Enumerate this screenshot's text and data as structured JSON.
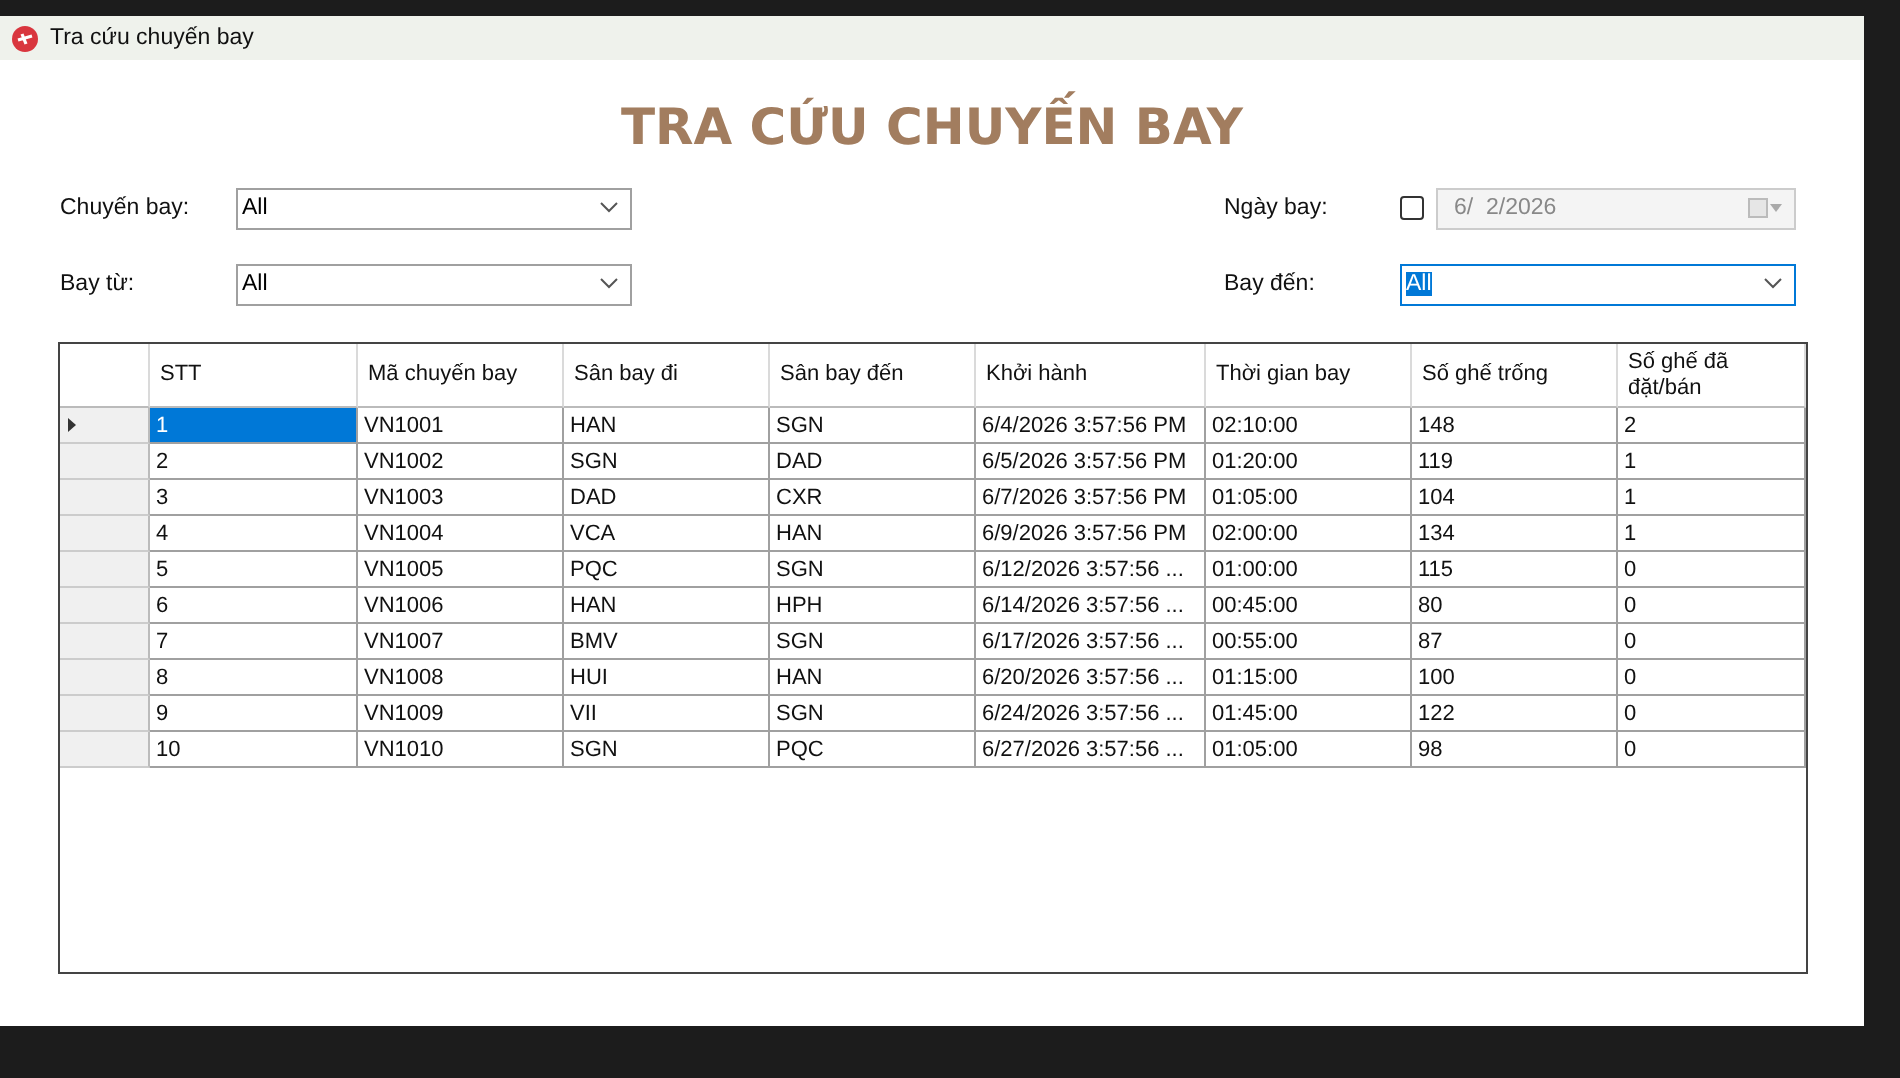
{
  "window": {
    "title": "Tra cứu chuyến bay"
  },
  "heading": "TRA CỨU CHUYẾN BAY",
  "filters": [
    {
      "kind": "combo",
      "label": "Chuyến bay:",
      "value": "All",
      "focused": false
    },
    {
      "kind": "date",
      "label": "Ngày bay:",
      "value": "6/  2/2026",
      "checked": false
    },
    {
      "kind": "combo",
      "label": "Bay từ:",
      "value": "All",
      "focused": false
    },
    {
      "kind": "combo",
      "label": "Bay đến:",
      "value": "All",
      "focused": true
    }
  ],
  "table": {
    "columns": [
      "STT",
      "Mã chuyến bay",
      "Sân bay đi",
      "Sân bay đến",
      "Khởi hành",
      "Thời gian bay",
      "Số ghế trống",
      "Số ghế đã đặt/bán"
    ],
    "rows": [
      {
        "selected": true,
        "cells": [
          "1",
          "VN1001",
          "HAN",
          "SGN",
          "6/4/2026 3:57:56 PM",
          "02:10:00",
          "148",
          "2"
        ]
      },
      {
        "selected": false,
        "cells": [
          "2",
          "VN1002",
          "SGN",
          "DAD",
          "6/5/2026 3:57:56 PM",
          "01:20:00",
          "119",
          "1"
        ]
      },
      {
        "selected": false,
        "cells": [
          "3",
          "VN1003",
          "DAD",
          "CXR",
          "6/7/2026 3:57:56 PM",
          "01:05:00",
          "104",
          "1"
        ]
      },
      {
        "selected": false,
        "cells": [
          "4",
          "VN1004",
          "VCA",
          "HAN",
          "6/9/2026 3:57:56 PM",
          "02:00:00",
          "134",
          "1"
        ]
      },
      {
        "selected": false,
        "cells": [
          "5",
          "VN1005",
          "PQC",
          "SGN",
          "6/12/2026 3:57:56 ...",
          "01:00:00",
          "115",
          "0"
        ]
      },
      {
        "selected": false,
        "cells": [
          "6",
          "VN1006",
          "HAN",
          "HPH",
          "6/14/2026 3:57:56 ...",
          "00:45:00",
          "80",
          "0"
        ]
      },
      {
        "selected": false,
        "cells": [
          "7",
          "VN1007",
          "BMV",
          "SGN",
          "6/17/2026 3:57:56 ...",
          "00:55:00",
          "87",
          "0"
        ]
      },
      {
        "selected": false,
        "cells": [
          "8",
          "VN1008",
          "HUI",
          "HAN",
          "6/20/2026 3:57:56 ...",
          "01:15:00",
          "100",
          "0"
        ]
      },
      {
        "selected": false,
        "cells": [
          "9",
          "VN1009",
          "VII",
          "SGN",
          "6/24/2026 3:57:56 ...",
          "01:45:00",
          "122",
          "0"
        ]
      },
      {
        "selected": false,
        "cells": [
          "10",
          "VN1010",
          "SGN",
          "PQC",
          "6/27/2026 3:57:56 ...",
          "01:05:00",
          "98",
          "0"
        ]
      }
    ]
  }
}
